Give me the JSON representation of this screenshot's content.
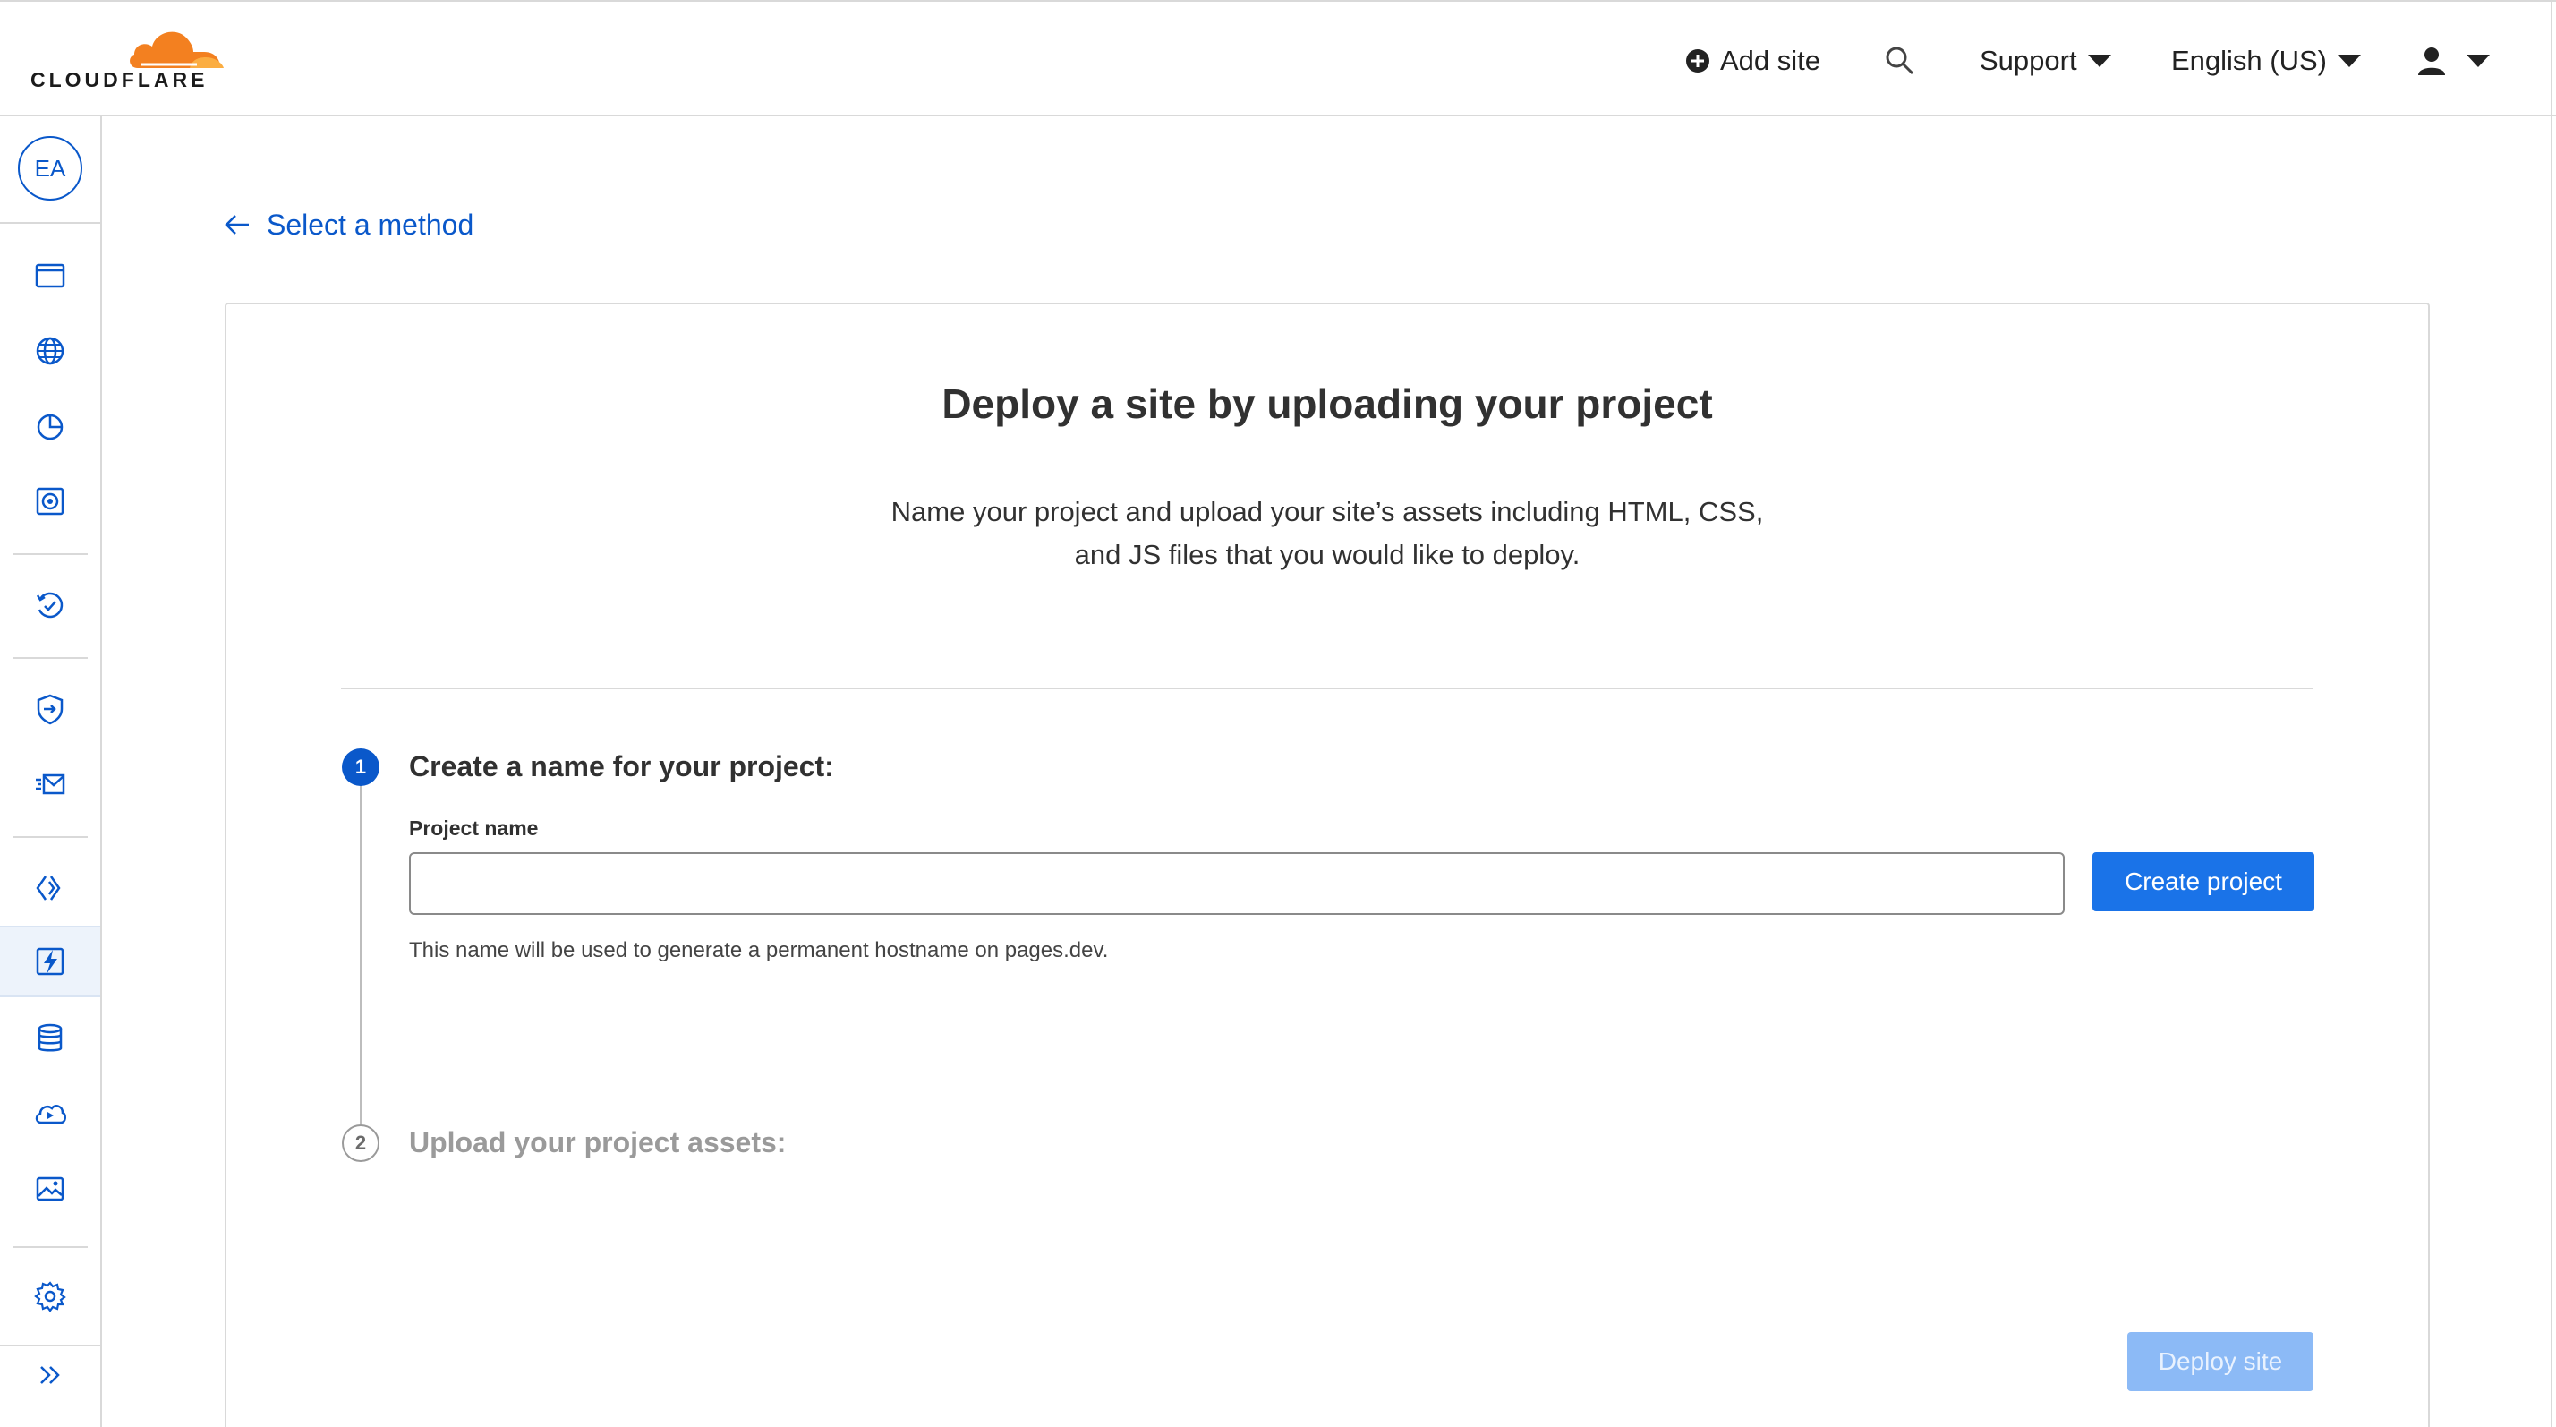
{
  "brand": {
    "logo_text": "CLOUDFLARE",
    "accent": "#f38020",
    "link_color": "#0a58ca",
    "button_color": "#1a73e8"
  },
  "header": {
    "add_site": "Add site",
    "support": "Support",
    "language": "English (US)"
  },
  "sidebar": {
    "avatar": "EA",
    "icons": [
      "websites-icon",
      "globe-icon",
      "analytics-icon",
      "security-center-icon",
      "trace-icon",
      "zero-trust-icon",
      "email-icon",
      "workers-icon",
      "pages-icon",
      "database-icon",
      "stream-icon",
      "images-icon",
      "settings-icon",
      "expand-icon"
    ],
    "active": "pages-icon"
  },
  "main": {
    "back_link": "Select a method",
    "card": {
      "title": "Deploy a site by uploading your project",
      "description_line1": "Name your project and upload your site’s assets including HTML, CSS,",
      "description_line2": "and JS files that you would like to deploy.",
      "step1": {
        "number": "1",
        "title": "Create a name for your project:",
        "field_label": "Project name",
        "input_value": "",
        "button": "Create project",
        "hint": "This name will be used to generate a permanent hostname on pages.dev."
      },
      "step2": {
        "number": "2",
        "title": "Upload your project assets:"
      },
      "deploy_button": "Deploy site"
    }
  }
}
